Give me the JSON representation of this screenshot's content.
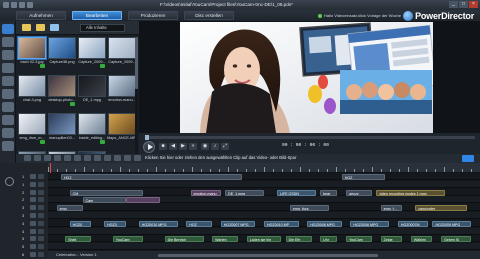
{
  "window": {
    "title": "F:\\Videos\\Initial\\YouCam\\Project files\\YouCam-trnc-DE\\1_08.pds*",
    "minimize": "_",
    "maximize": "□",
    "close": "×"
  },
  "modes": [
    "Aufnehmen",
    "Bearbeiten",
    "Produzieren",
    "Disc erstellen"
  ],
  "status_text": "Hallo Videoeinsatz,klick Vorlage der Woche",
  "brand": "PowerDirector",
  "library": {
    "filter": "Alle Inhalte",
    "items": [
      {
        "label": "bach 02-3.jpg",
        "selected": true
      },
      {
        "label": "Capture38.png",
        "selected": false
      },
      {
        "label": "Capture_2009...",
        "selected": false
      },
      {
        "label": "Capture_2009...",
        "selected": false
      },
      {
        "label": "chat-3.png",
        "selected": false
      },
      {
        "label": "desktop-photo...",
        "selected": false
      },
      {
        "label": "DE_1.mpg",
        "selected": false
      },
      {
        "label": "emotion-manu...",
        "selected": false
      },
      {
        "label": "emg_4sm_m...",
        "selected": false
      },
      {
        "label": "manupilien03...",
        "selected": false
      },
      {
        "label": "inside_editing...",
        "selected": false
      },
      {
        "label": "Maps_ANCE-MP4",
        "selected": false
      }
    ]
  },
  "player": {
    "timecode": "00 : 00 : 00 : 00",
    "play_label": "Play"
  },
  "hint": "Klicken Sie hier oder ziehen den ausgewählten Clip auf das Video- oder Bild-Spur",
  "timeline": {
    "ruler_ticks": [
      "00:00:00:00",
      "00:00:08:10",
      "00:00:16:20",
      "00:00:25:00",
      "00:00:33:10",
      "00:00:41:20",
      "00:00:50:00"
    ],
    "track_numbers": [
      "1",
      "1",
      "2",
      "2",
      "3",
      "3",
      "4",
      "4",
      "5",
      "5",
      "6",
      "6"
    ],
    "clips": [
      {
        "row": 0,
        "type": "video",
        "label": "HGZ",
        "start": 0.03,
        "end": 0.45
      },
      {
        "row": 0,
        "type": "video",
        "label": "HGZ",
        "start": 0.68,
        "end": 0.78
      },
      {
        "row": 2,
        "type": "video",
        "label": "CM",
        "start": 0.05,
        "end": 0.22
      },
      {
        "row": 2,
        "type": "fx",
        "label": "emotion-manu",
        "start": 0.33,
        "end": 0.4
      },
      {
        "row": 2,
        "type": "video",
        "label": "DE_1.mpg",
        "start": 0.41,
        "end": 0.5
      },
      {
        "row": 2,
        "type": "tr",
        "label": "LIFE OSDN",
        "start": 0.53,
        "end": 0.62
      },
      {
        "row": 2,
        "type": "video",
        "label": "bear",
        "start": 0.63,
        "end": 0.67
      },
      {
        "row": 2,
        "type": "video",
        "label": "geozz",
        "start": 0.69,
        "end": 0.75
      },
      {
        "row": 2,
        "type": "title",
        "label": "video recording modes 1.mpg",
        "start": 0.76,
        "end": 0.92
      },
      {
        "row": 3,
        "type": "video",
        "label": "Cam",
        "start": 0.08,
        "end": 0.18
      },
      {
        "row": 3,
        "type": "fx",
        "label": "",
        "start": 0.18,
        "end": 0.26
      },
      {
        "row": 4,
        "type": "video",
        "label": "emg",
        "start": 0.02,
        "end": 0.08
      },
      {
        "row": 4,
        "type": "video",
        "label": "emg_thcs",
        "start": 0.56,
        "end": 0.65
      },
      {
        "row": 4,
        "type": "video",
        "label": "emg_f...",
        "start": 0.77,
        "end": 0.82
      },
      {
        "row": 4,
        "type": "title",
        "label": "camcorder",
        "start": 0.85,
        "end": 0.97
      },
      {
        "row": 6,
        "type": "tr",
        "label": "HGZ0",
        "start": 0.05,
        "end": 0.1
      },
      {
        "row": 6,
        "type": "tr",
        "label": "HGZ0",
        "start": 0.13,
        "end": 0.18
      },
      {
        "row": 6,
        "type": "tr",
        "label": "HGZ0010 MPG",
        "start": 0.21,
        "end": 0.3
      },
      {
        "row": 6,
        "type": "tr",
        "label": "HGZ",
        "start": 0.32,
        "end": 0.38
      },
      {
        "row": 6,
        "type": "tr",
        "label": "HGZ0007 MPG",
        "start": 0.4,
        "end": 0.48
      },
      {
        "row": 6,
        "type": "tr",
        "label": "HGZ0010 MP",
        "start": 0.5,
        "end": 0.58
      },
      {
        "row": 6,
        "type": "tr",
        "label": "HGZ0008 MPG",
        "start": 0.6,
        "end": 0.68
      },
      {
        "row": 6,
        "type": "tr",
        "label": "HGZ0006 MPG",
        "start": 0.7,
        "end": 0.79
      },
      {
        "row": 6,
        "type": "tr",
        "label": "HGZ0007M",
        "start": 0.81,
        "end": 0.88
      },
      {
        "row": 6,
        "type": "tr",
        "label": "HGZ0009 MPG",
        "start": 0.89,
        "end": 0.98
      },
      {
        "row": 8,
        "type": "audio",
        "label": "Shell",
        "start": 0.04,
        "end": 0.1
      },
      {
        "row": 8,
        "type": "audio",
        "label": "YouCam",
        "start": 0.15,
        "end": 0.22
      },
      {
        "row": 8,
        "type": "audio",
        "label": "Die Bereich",
        "start": 0.27,
        "end": 0.36
      },
      {
        "row": 8,
        "type": "audio",
        "label": "Warten",
        "start": 0.38,
        "end": 0.44
      },
      {
        "row": 8,
        "type": "audio",
        "label": "Laden sie hin",
        "start": 0.46,
        "end": 0.54
      },
      {
        "row": 8,
        "type": "audio",
        "label": "Die Efn",
        "start": 0.55,
        "end": 0.61
      },
      {
        "row": 8,
        "type": "audio",
        "label": "Uhr",
        "start": 0.63,
        "end": 0.67
      },
      {
        "row": 8,
        "type": "audio",
        "label": "YouCam",
        "start": 0.69,
        "end": 0.75
      },
      {
        "row": 8,
        "type": "audio",
        "label": "Zeige",
        "start": 0.77,
        "end": 0.82
      },
      {
        "row": 8,
        "type": "audio",
        "label": "Wählen",
        "start": 0.84,
        "end": 0.89
      },
      {
        "row": 8,
        "type": "audio",
        "label": "Geben Si",
        "start": 0.91,
        "end": 0.98
      }
    ],
    "footer_label": "Celebration - Version 1"
  },
  "colors": {
    "accent": "#2f86e6",
    "play_cursor": "#e34a3c"
  }
}
